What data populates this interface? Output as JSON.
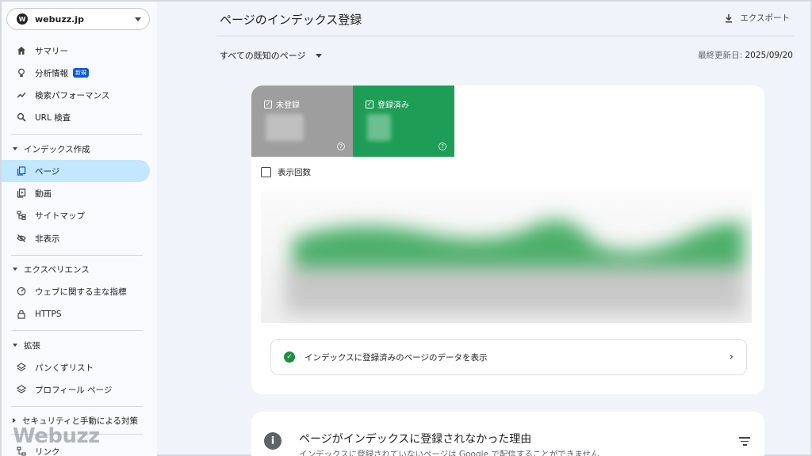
{
  "property": {
    "name": "webuzz.jp",
    "logo": "W"
  },
  "sidebar": {
    "top_items": [
      {
        "label": "サマリー",
        "icon": "home-icon"
      },
      {
        "label": "分析情報",
        "icon": "lightbulb-icon",
        "badge": "新規"
      },
      {
        "label": "検索パフォーマンス",
        "icon": "trending-icon"
      },
      {
        "label": "URL 検査",
        "icon": "search-icon"
      }
    ],
    "index_section": "インデックス作成",
    "index_items": [
      {
        "label": "ページ",
        "icon": "pages-icon"
      },
      {
        "label": "動画",
        "icon": "video-icon"
      },
      {
        "label": "サイトマップ",
        "icon": "sitemap-icon"
      },
      {
        "label": "非表示",
        "icon": "eye-off-icon"
      }
    ],
    "experience_section": "エクスペリエンス",
    "experience_items": [
      {
        "label": "ウェブに関する主な指標",
        "icon": "gauge-icon"
      },
      {
        "label": "HTTPS",
        "icon": "lock-icon"
      }
    ],
    "enhance_section": "拡張",
    "enhance_items": [
      {
        "label": "パンくずリスト",
        "icon": "layers-icon"
      },
      {
        "label": "プロフィール ページ",
        "icon": "layers-icon"
      }
    ],
    "security_section": "セキュリティと手動による対策",
    "links_item": "リンク"
  },
  "watermark": "Webuzz",
  "header": {
    "title": "ページのインデックス登録",
    "export_label": "エクスポート"
  },
  "filter": {
    "selected": "すべての既知のページ"
  },
  "updated": {
    "label": "最終更新日:",
    "date": "2025/09/20"
  },
  "tiles": {
    "not_indexed": "未登録",
    "indexed": "登録済み",
    "help": "?"
  },
  "impressions_label": "表示回数",
  "colors": {
    "indexed": "#1e9d57",
    "not_indexed": "#9e9e9e",
    "active_nav": "#c2e7ff"
  },
  "view_data_label": "インデックスに登録済みのページのデータを表示",
  "reasons": {
    "title": "ページがインデックスに登録されなかった理由",
    "subtitle": "インデックスに登録されていないページは Google で配信することができません"
  }
}
